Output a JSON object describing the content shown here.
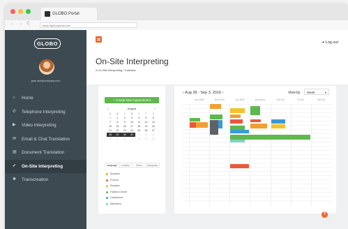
{
  "window": {
    "tab_title": "GLOBO Portal",
    "url": "https://globoportal.com",
    "nav_arrows": "← → C"
  },
  "sidebar": {
    "logo": "GLOBO",
    "user_email": "jane.doe@company.com",
    "items": [
      {
        "label": "Home",
        "icon": "home-icon",
        "glyph": "⌂",
        "active": false
      },
      {
        "label": "Telephone Interpreting",
        "icon": "phone-icon",
        "glyph": "✆",
        "active": false
      },
      {
        "label": "Video Interpreting",
        "icon": "video-icon",
        "glyph": "▶",
        "active": false
      },
      {
        "label": "Email & Chat Translation",
        "icon": "chat-icon",
        "glyph": "✉",
        "active": false
      },
      {
        "label": "Document Translation",
        "icon": "document-icon",
        "glyph": "▤",
        "active": false
      },
      {
        "label": "On-Site Interpreting",
        "icon": "checkmark-icon",
        "glyph": "✓",
        "active": true
      },
      {
        "label": "Transcreation",
        "icon": "globe-icon",
        "glyph": "✱",
        "active": false
      }
    ]
  },
  "topbar": {
    "logout_label": "⇥ Log out"
  },
  "header": {
    "title": "On-Site Interpreting",
    "breadcrumb": "# On-Site Interpreting / Calendar"
  },
  "left_panel": {
    "create_button": "+ Create New Appointment",
    "mini_calendar": {
      "month": "August",
      "prev": "‹",
      "next": "›",
      "weekdays": [
        "S",
        "M",
        "T",
        "W",
        "T",
        "F",
        "S"
      ],
      "weeks": [
        [
          "31",
          "1",
          "2",
          "3",
          "4",
          "5",
          "6"
        ],
        [
          "7",
          "8",
          "9",
          "10",
          "11",
          "12",
          "13"
        ],
        [
          "14",
          "15",
          "16",
          "17",
          "18",
          "19",
          "20"
        ],
        [
          "21",
          "22",
          "23",
          "24",
          "25",
          "26",
          "27"
        ],
        [
          "28",
          "29",
          "30",
          "31",
          "1",
          "2",
          "3"
        ],
        [
          "4",
          "5",
          "6",
          "7",
          "8",
          "9",
          "10"
        ]
      ]
    },
    "tabs": [
      "Language",
      "Location",
      "Client",
      "Interpreter"
    ],
    "languages": [
      {
        "label": "Spanish",
        "color": "#f0a030"
      },
      {
        "label": "French",
        "color": "#e85a3c"
      },
      {
        "label": "Russian",
        "color": "#f2c22e"
      },
      {
        "label": "Haitian Creole",
        "color": "#5fb84e"
      },
      {
        "label": "Cantonese",
        "color": "#3a9ad9"
      },
      {
        "label": "Mandarin",
        "color": "#7ed3c4"
      }
    ]
  },
  "calendar": {
    "date_range": "‹ Aug 28 - Sep 3, 2016 ›",
    "view_by_label": "View by",
    "view_value": "Week",
    "view_caret": "▾",
    "days": [
      "Sun 8/28",
      "Mon 8/29",
      "Tue 8/30",
      "Wed 8/31",
      "Thu 9/1",
      "Fri 9/2",
      "Sat 9/3"
    ],
    "help": "?"
  },
  "colors": {
    "sidebar": "#3d4a52",
    "accent": "#f0662c",
    "create": "#5fb84e"
  }
}
